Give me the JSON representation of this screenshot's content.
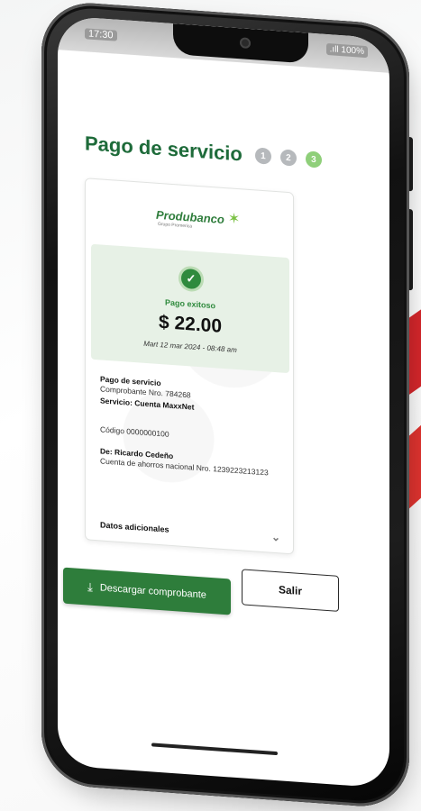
{
  "status_bar": {
    "time": "17:30",
    "signal_battery": ".ıll 100%"
  },
  "header": {
    "title_prefix": "Pago de ",
    "title_suffix": "servicio",
    "steps": [
      "1",
      "2",
      "3"
    ]
  },
  "receipt": {
    "brand_name": "Produbanco",
    "brand_tagline": "Grupo Promerica",
    "success_text": "Pago exitoso",
    "amount": "$ 22.00",
    "datetime": "Mart 12 mar 2024 - 08:48 am",
    "service_title": "Pago de servicio",
    "voucher": "Comprobante Nro. 784268",
    "service": "Servicio: Cuenta MaxxNet",
    "code": "Código 0000000100",
    "from": "De: Ricardo Cedeño",
    "account": "Cuenta de ahorros nacional Nro. 1239223213123",
    "extra_label": "Datos adicionales"
  },
  "actions": {
    "download_label": "Descargar comprobante",
    "exit_label": "Salir"
  },
  "colors": {
    "brand_green": "#2e7d3b",
    "success_bg": "#e7f1e6",
    "accent_red": "#d6262b"
  },
  "icons": [
    "check-icon",
    "download-icon",
    "chevron-down-icon",
    "star-logo-icon"
  ]
}
